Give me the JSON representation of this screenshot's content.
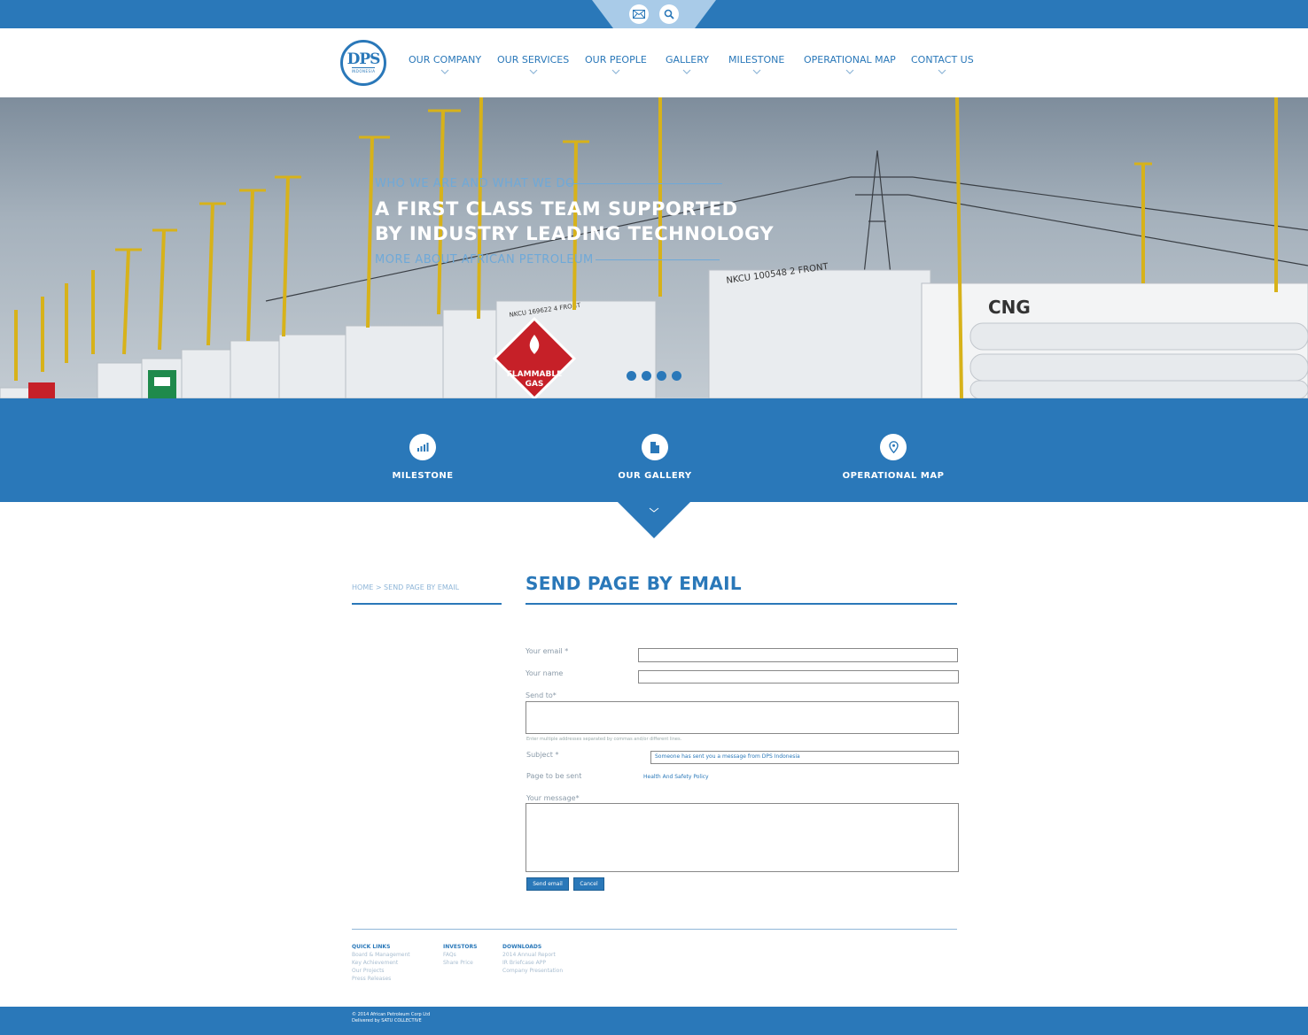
{
  "topbar": {
    "icons": [
      "envelope-icon",
      "search-icon"
    ],
    "accent": "#2a78b9"
  },
  "logo": {
    "main": "DPS",
    "sub": "INDONESIA"
  },
  "nav": [
    {
      "label": "OUR COMPANY"
    },
    {
      "label": "OUR SERVICES"
    },
    {
      "label": "OUR PEOPLE"
    },
    {
      "label": "GALLERY"
    },
    {
      "label": "MILESTONE"
    },
    {
      "label": "OPERATIONAL MAP"
    },
    {
      "label": "CONTACT US"
    }
  ],
  "hero": {
    "eyebrow": "WHO WE ARE AND WHAT WE DO",
    "title_line1": "A FIRST CLASS TEAM SUPPORTED",
    "title_line2": "BY INDUSTRY LEADING TECHNOLOGY",
    "more": "MORE ABOUT AFRICAN PETROLEUM",
    "sign_text_1": "FLAMMABLE",
    "sign_text_2": "GAS",
    "container_label_1": "NKCU 100548 2  FRONT",
    "container_label_2": "CNG",
    "container_label_3": "NKCU 169622 4  FRONT",
    "slide_count": 4
  },
  "features": [
    {
      "label": "MILESTONE",
      "icon": "bar-chart-icon"
    },
    {
      "label": "OUR GALLERY",
      "icon": "document-icon"
    },
    {
      "label": "OPERATIONAL MAP",
      "icon": "map-pin-icon"
    }
  ],
  "breadcrumb": "HOME > SEND PAGE BY EMAIL",
  "page_title": "SEND PAGE BY EMAIL",
  "form": {
    "email_label": "Your email *",
    "email_value": "",
    "name_label": "Your name",
    "name_value": "",
    "sendto_label": "Send to*",
    "sendto_value": "",
    "hint": "Enter multiple addresses separated by commas and/or different lines.",
    "subject_label": "Subject *",
    "subject_value": "Someone has sent you a message from DPS Indonesia",
    "page_label": "Page to be sent",
    "page_value": "Health And Safety Policy",
    "message_label": "Your message*",
    "message_value": "",
    "send_button": "Send email",
    "cancel_button": "Cancel"
  },
  "footer": {
    "columns": [
      {
        "head": "QUICK LINKS",
        "links": [
          "Board & Management",
          "Key Achievement",
          "Our Projects",
          "Press Releases"
        ]
      },
      {
        "head": "INVESTORS",
        "links": [
          "FAQs",
          "Share Price"
        ]
      },
      {
        "head": "DOWNLOADS",
        "links": [
          "2014 Annual Report",
          "IR Briefcase APP",
          "Company Presentation"
        ]
      }
    ],
    "copyright": "© 2014 African Petroleum Corp Ltd",
    "delivered": "Delivered by SATU COLLECTIVE"
  }
}
